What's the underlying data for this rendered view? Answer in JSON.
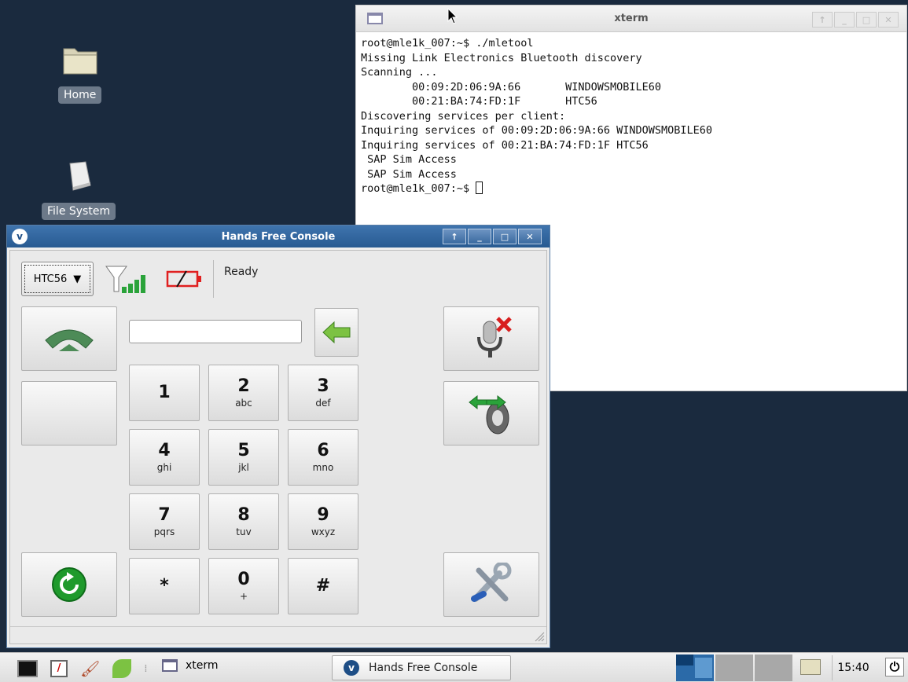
{
  "desktop": {
    "icons": [
      {
        "label": "Home",
        "icon": "folder-icon"
      },
      {
        "label": "File System",
        "icon": "drive-icon"
      }
    ]
  },
  "xterm": {
    "title": "xterm",
    "lines": [
      "root@mle1k_007:~$ ./mletool",
      "Missing Link Electronics Bluetooth discovery",
      "Scanning ...",
      "        00:09:2D:06:9A:66       WINDOWSMOBILE60",
      "        00:21:BA:74:FD:1F       HTC56",
      "Discovering services per client:",
      "Inquiring services of 00:09:2D:06:9A:66 WINDOWSMOBILE60",
      "Inquiring services of 00:21:BA:74:FD:1F HTC56",
      " SAP Sim Access",
      " SAP Sim Access"
    ],
    "prompt": "root@mle1k_007:~$ "
  },
  "hfc": {
    "title": "Hands Free Console",
    "device_selected": "HTC56",
    "status": "Ready",
    "dial_value": "",
    "keys": [
      {
        "num": "1",
        "sub": ""
      },
      {
        "num": "2",
        "sub": "abc"
      },
      {
        "num": "3",
        "sub": "def"
      },
      {
        "num": "4",
        "sub": "ghi"
      },
      {
        "num": "5",
        "sub": "jkl"
      },
      {
        "num": "6",
        "sub": "mno"
      },
      {
        "num": "7",
        "sub": "pqrs"
      },
      {
        "num": "8",
        "sub": "tuv"
      },
      {
        "num": "9",
        "sub": "wxyz"
      },
      {
        "num": "*",
        "sub": ""
      },
      {
        "num": "0",
        "sub": "+"
      },
      {
        "num": "#",
        "sub": ""
      }
    ],
    "colors": {
      "accent": "#2b6aa8",
      "call_green": "#4d8b57",
      "refresh_green": "#1f9a2c",
      "battery_red": "#e02020"
    }
  },
  "taskbar": {
    "tasks": [
      {
        "label": "xterm"
      },
      {
        "label": "Hands Free Console"
      }
    ],
    "clock": "15:40"
  }
}
